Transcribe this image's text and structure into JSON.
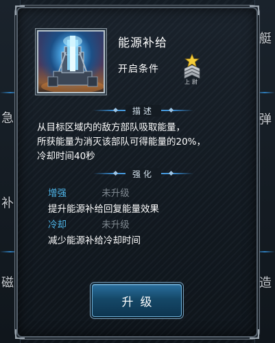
{
  "background": {
    "left_chars": [
      "急",
      "补",
      "磁"
    ],
    "right_chars": [
      "艇",
      "弹",
      "造"
    ]
  },
  "skill": {
    "icon": "energy-tower-icon",
    "title": "能源补给",
    "unlock_condition_label": "开启条件",
    "rank_icon": "rank-insignia-star-chevrons-icon",
    "rank_label": "上尉"
  },
  "description": {
    "header": "描述",
    "text": "从目标区域内的敌方部队吸取能量，\n所获能量为消灭该部队可得能量的20%，\n冷却时间40秒"
  },
  "enhance": {
    "header": "强化",
    "items": [
      {
        "name": "增强",
        "status": "未升级",
        "effect": "提升能源补给回复能量效果"
      },
      {
        "name": "冷却",
        "status": "未升级",
        "effect": "减少能源补给冷却时间"
      }
    ]
  },
  "upgrade_button": {
    "label": "升级"
  },
  "colors": {
    "accent_blue": "#4fb6ea",
    "status_gray": "#7f8890",
    "button_blue": "#1a5a85"
  }
}
